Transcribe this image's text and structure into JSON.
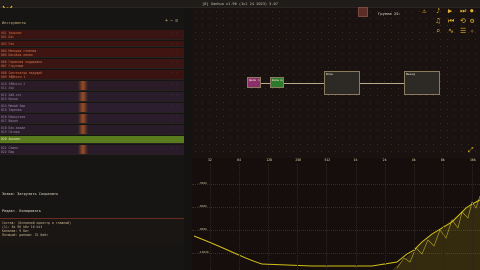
{
  "window": {
    "title": "[8] Ganhua v1.96 (Jul 24 2023) 5.07"
  },
  "left_panel": {
    "header_label": "Инструменты",
    "header_icons": [
      "add-icon",
      "minus-icon",
      "menu-icon"
    ],
    "rows": [
      {
        "lines": [
          "001 Ударные",
          "002 Бас"
        ],
        "color": "#c86a3a",
        "bg": "#3a1412",
        "h": 10
      },
      {
        "lines": [
          "003 Pad"
        ],
        "color": "#c86a3a",
        "bg": "#3d1310",
        "h": 6
      },
      {
        "lines": [
          "004 Мелодия главная",
          "005 Басовая линия"
        ],
        "color": "#d2744a",
        "bg": "#3f1411",
        "h": 10
      },
      {
        "lines": [
          "006 Гармония поддержка",
          "007 Струнные"
        ],
        "color": "#d2744a",
        "bg": "#3b1512",
        "h": 10
      },
      {
        "lines": [
          "008 Синтезатор ведущий",
          "009 Эффекты 1"
        ],
        "color": "#d2744a",
        "bg": "#3a1311",
        "h": 10
      },
      {
        "lines": [
          "010 Эффекты 2",
          "011 Хор"
        ],
        "color": "#8e7a9a",
        "bg": "#2a1b26",
        "h": 10
      },
      {
        "lines": [
          "012 Хай-хэт",
          "013 Бочка"
        ],
        "color": "#9a88aa",
        "bg": "#2a1d2b",
        "h": 10
      },
      {
        "lines": [
          "014 Малый бар",
          "015 Тарелки"
        ],
        "color": "#9a88aa",
        "bg": "#2c1e2e",
        "h": 10
      },
      {
        "lines": [
          "016 Перкуссия",
          "017 Вокал"
        ],
        "color": "#9a88aa",
        "bg": "#2a1c2a",
        "h": 10
      },
      {
        "lines": [
          "018 Бэк-вокал",
          "019 Гитара"
        ],
        "color": "#9a88aa",
        "bg": "#281c28",
        "h": 10
      },
      {
        "lines": [
          "020 Аккомп."
        ],
        "color": "#e8e0c0",
        "bg": "#5a7a1e",
        "h": 8,
        "selected": true
      },
      {
        "lines": [
          "021 Сэмпл",
          "022 Пад"
        ],
        "color": "#9a88aa",
        "bg": "#291b29",
        "h": 10
      }
    ],
    "footer_text": "Знаки: Загрузить Сохранить",
    "footer_text2": "Редакт. Копировать",
    "info_lines": [
      "Состав: (Основной оркестр и главный)",
      "(1): 8x 96 kHz 16 bit",
      "Каналов: 9 бит",
      "Позиций: данные: 32 байт"
    ]
  },
  "graph": {
    "group_label": "Группа 25:",
    "nodes": [
      {
        "label": "Дели 1",
        "color": "#8a2f6a"
      },
      {
        "label": "Фильтр",
        "color": "#2c7a2c"
      },
      {
        "label": "Блок",
        "color": "#7a7a22"
      },
      {
        "label": "Выход",
        "color": "#7a7a22"
      }
    ],
    "right_icons": [
      "play-icon",
      "stop-icon",
      "record-icon",
      "sample-icon",
      "settings-icon",
      "zoom-icon"
    ]
  },
  "spectrum": {
    "freq_ticks": [
      "32",
      "64",
      "128",
      "256",
      "512",
      "1k",
      "2k",
      "4k",
      "8k",
      "16k"
    ],
    "db_labels": [
      "-30db",
      "-60db",
      "-90db",
      "-120db"
    ],
    "accent": "#e8d41a"
  }
}
